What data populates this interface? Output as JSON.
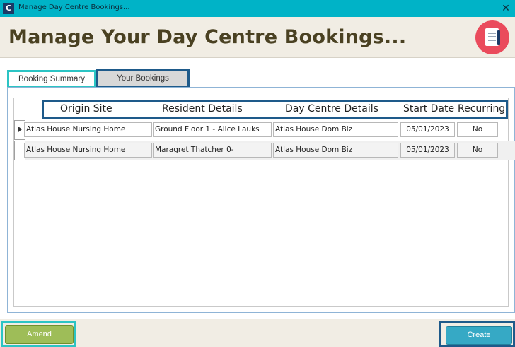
{
  "window": {
    "app_icon_letter": "C",
    "title": "Manage Day Centre Bookings...",
    "close_glyph": "✕"
  },
  "header": {
    "title": "Manage Your Day Centre Bookings...",
    "icon": "booking-clipboard-icon"
  },
  "tabs": [
    {
      "label": "Booking Summary",
      "active": true
    },
    {
      "label": "Your Bookings",
      "active": false
    }
  ],
  "grid": {
    "columns": [
      "Origin Site",
      "Resident Details",
      "Day Centre Details",
      "Start Date",
      "Recurring"
    ],
    "rows": [
      {
        "origin_site": "Atlas House Nursing Home",
        "resident": "Ground Floor 1 - Alice Lauks",
        "day_centre": "Atlas House Dom Biz",
        "start_date": "05/01/2023",
        "recurring": "No"
      },
      {
        "origin_site": "Atlas House Nursing Home",
        "resident": "Maragret Thatcher 0-",
        "day_centre": "Atlas House Dom Biz",
        "start_date": "05/01/2023",
        "recurring": "No"
      }
    ]
  },
  "footer": {
    "amend_label": "Amend",
    "create_label": "Create"
  },
  "colors": {
    "titlebar": "#00b3c7",
    "title_text": "#4a4122",
    "amend": "#9ebd58",
    "create": "#36a9c5",
    "highlight_teal": "#2bc4c4",
    "highlight_navy": "#1e5a8a"
  }
}
